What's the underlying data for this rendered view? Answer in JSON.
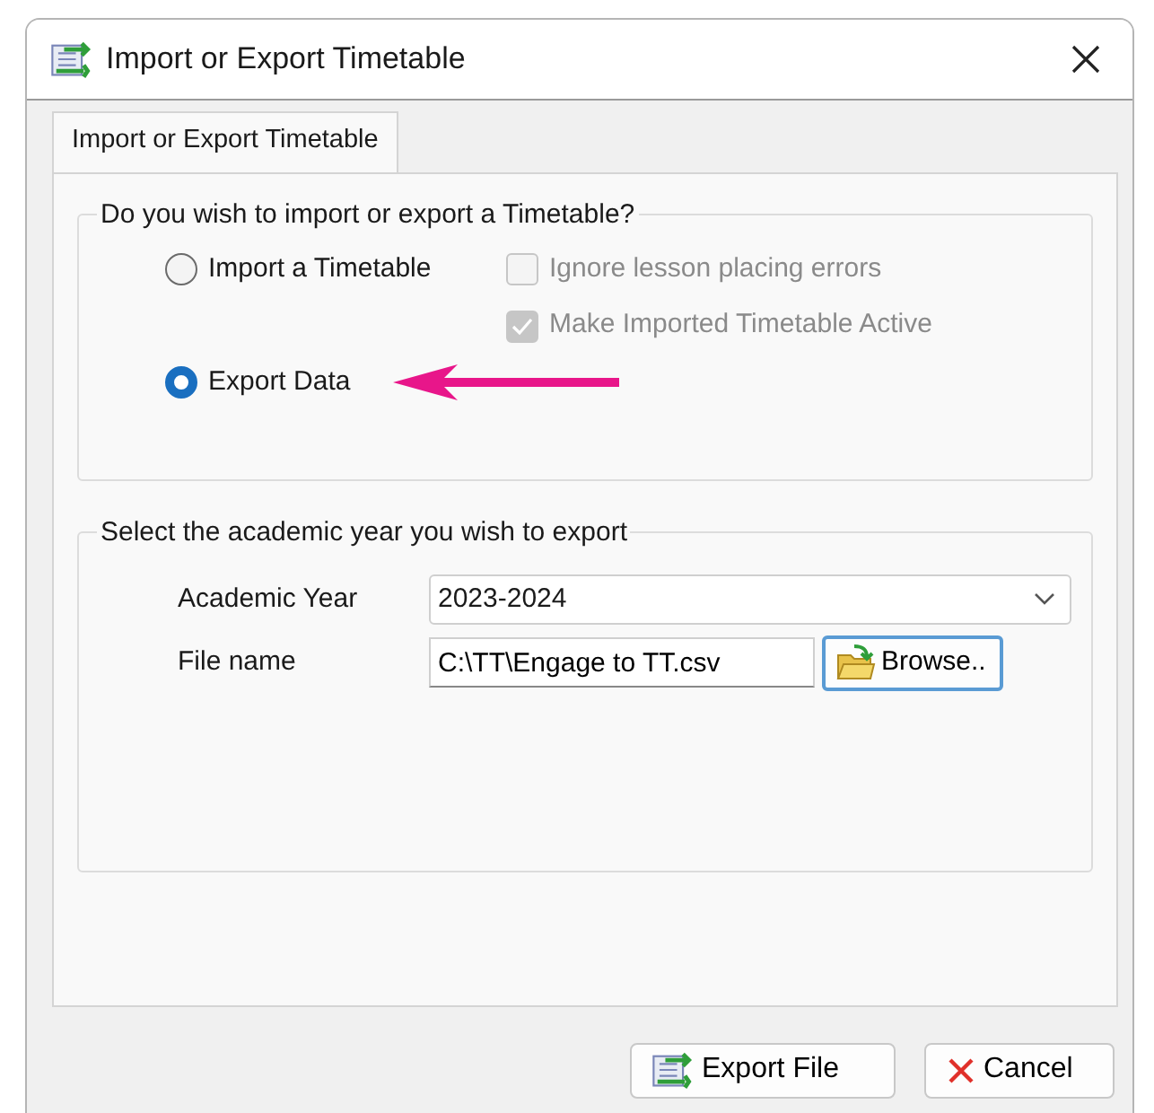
{
  "window": {
    "title": "Import or Export Timetable"
  },
  "tabs": [
    {
      "label": "Import or Export Timetable",
      "selected": true
    }
  ],
  "mode_group": {
    "title": "Do you wish to import or export a Timetable?",
    "options": [
      {
        "label": "Import a Timetable",
        "selected": false
      },
      {
        "label": "Export Data",
        "selected": true
      }
    ],
    "import_options": [
      {
        "label": "Ignore lesson placing errors",
        "checked": false,
        "disabled": true
      },
      {
        "label": "Make Imported Timetable Active",
        "checked": true,
        "disabled": true
      }
    ]
  },
  "export_group": {
    "title": "Select the academic year you wish to export",
    "fields": [
      {
        "kind": "dropdown",
        "label": "Academic Year",
        "value": "2023-2024"
      },
      {
        "kind": "file",
        "label": "File name",
        "value": "C:\\TT\\Engage to TT.csv",
        "button": "Browse.."
      }
    ]
  },
  "buttons": [
    {
      "kind": "export",
      "label": "Export File"
    },
    {
      "kind": "cancel",
      "label": "Cancel"
    }
  ]
}
